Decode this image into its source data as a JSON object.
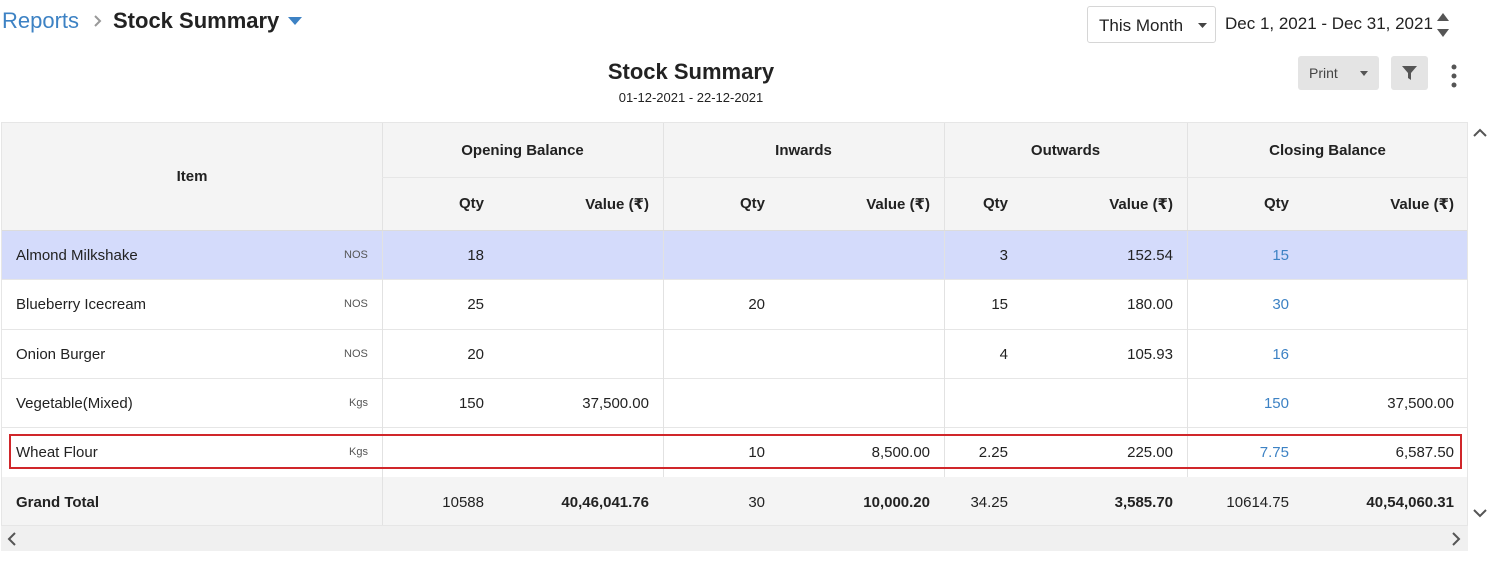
{
  "breadcrumb": {
    "parent": "Reports",
    "current": "Stock Summary"
  },
  "period": {
    "selected": "This Month",
    "range": "Dec 1, 2021 - Dec 31, 2021"
  },
  "report": {
    "title": "Stock Summary",
    "subtitle": "01-12-2021 - 22-12-2021"
  },
  "toolbar": {
    "print_label": "Print"
  },
  "table": {
    "item_header": "Item",
    "groups": [
      "Opening Balance",
      "Inwards",
      "Outwards",
      "Closing Balance"
    ],
    "qty_header": "Qty",
    "value_header": "Value (₹)",
    "rows": [
      {
        "item": "Almond Milkshake",
        "unit": "NOS",
        "open_qty": "18",
        "open_val": "",
        "in_qty": "",
        "in_val": "",
        "out_qty": "3",
        "out_val": "152.54",
        "close_qty": "15",
        "close_val": ""
      },
      {
        "item": "Blueberry Icecream",
        "unit": "NOS",
        "open_qty": "25",
        "open_val": "",
        "in_qty": "20",
        "in_val": "",
        "out_qty": "15",
        "out_val": "180.00",
        "close_qty": "30",
        "close_val": ""
      },
      {
        "item": "Onion Burger",
        "unit": "NOS",
        "open_qty": "20",
        "open_val": "",
        "in_qty": "",
        "in_val": "",
        "out_qty": "4",
        "out_val": "105.93",
        "close_qty": "16",
        "close_val": ""
      },
      {
        "item": "Vegetable(Mixed)",
        "unit": "Kgs",
        "open_qty": "150",
        "open_val": "37,500.00",
        "in_qty": "",
        "in_val": "",
        "out_qty": "",
        "out_val": "",
        "close_qty": "150",
        "close_val": "37,500.00"
      },
      {
        "item": "Wheat Flour",
        "unit": "Kgs",
        "open_qty": "",
        "open_val": "",
        "in_qty": "10",
        "in_val": "8,500.00",
        "out_qty": "2.25",
        "out_val": "225.00",
        "close_qty": "7.75",
        "close_val": "6,587.50"
      }
    ],
    "total": {
      "label": "Grand Total",
      "open_qty": "10588",
      "open_val": "40,46,041.76",
      "in_qty": "30",
      "in_val": "10,000.20",
      "out_qty": "34.25",
      "out_val": "3,585.70",
      "close_qty": "10614.75",
      "close_val": "40,54,060.31"
    }
  },
  "colors": {
    "link": "#3d82c4",
    "selected_row": "#d4dbfb",
    "highlight_border": "#d0262a",
    "header_bg": "#f4f4f4"
  },
  "icons": [
    "chevron-right-icon",
    "caret-down-icon",
    "sort-stepper-icon",
    "filter-icon",
    "kebab-menu-icon",
    "scroll-up-icon",
    "scroll-down-icon",
    "scroll-left-icon",
    "scroll-right-icon"
  ]
}
